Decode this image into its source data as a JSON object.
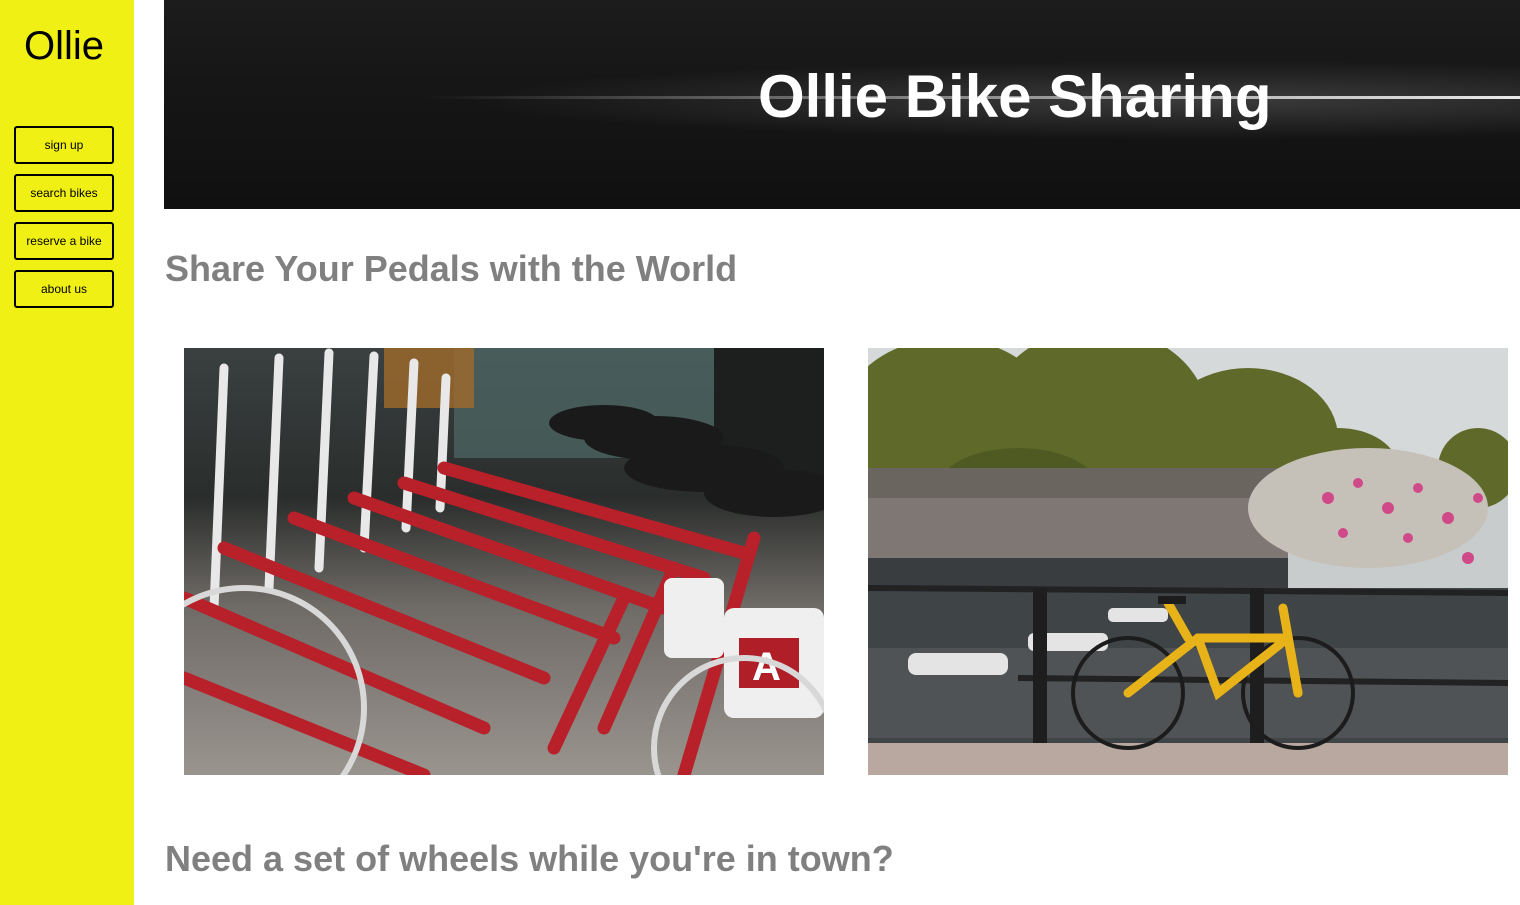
{
  "sidebar": {
    "logo": "Ollie",
    "items": [
      {
        "label": "sign up"
      },
      {
        "label": "search bikes"
      },
      {
        "label": "reserve a bike"
      },
      {
        "label": "about us"
      }
    ]
  },
  "hero": {
    "title": "Ollie Bike Sharing"
  },
  "sections": {
    "heading_1": "Share Your Pedals with the World",
    "heading_2": "Need a set of wheels while you're in town?"
  },
  "photos": [
    {
      "icon": "red-bikes-rack-photo"
    },
    {
      "icon": "yellow-bike-canal-photo"
    }
  ],
  "colors": {
    "sidebar": "#f0f014",
    "heading": "#808080",
    "hero_bg": "#161616"
  }
}
